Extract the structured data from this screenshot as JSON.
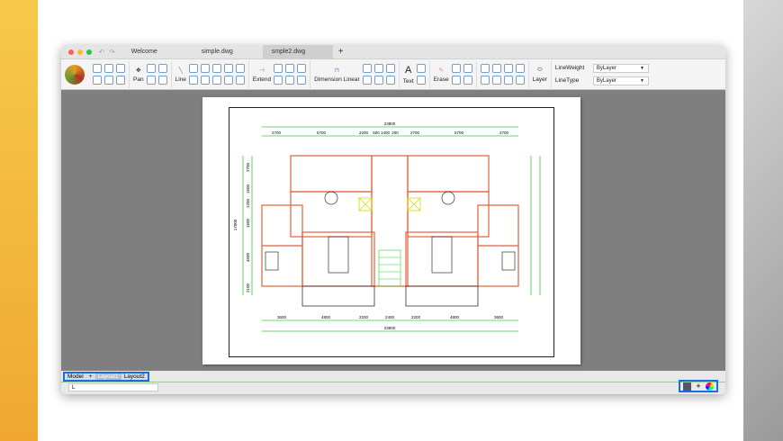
{
  "tabs": [
    "Welcome",
    "simple.dwg",
    "smple2.dwg"
  ],
  "toolbar": {
    "pan": "Pan",
    "line": "Line",
    "extend": "Extend",
    "dimension": "Dimension Linear",
    "text": "Text",
    "erase": "Erase",
    "layer": "Layer",
    "lineweight_label": "LineWeight",
    "lineweight_value": "ByLayer",
    "linetype_label": "LineType",
    "linetype_value": "ByLayer",
    "text_glyph": "A"
  },
  "drawing": {
    "top_total": "23800",
    "top_dims": [
      "2700",
      "5700",
      "2200",
      "500",
      "1400",
      "200",
      "2700",
      "5700",
      "2700"
    ],
    "bottom_dims": [
      "3600",
      "4800",
      "2200",
      "2400",
      "2200",
      "4800",
      "3600"
    ],
    "bottom_total": "23800",
    "side_total": "17000",
    "side_dims": [
      "2700",
      "1500",
      "1200",
      "1500",
      "4500",
      "2100"
    ]
  },
  "layouts": [
    "Model",
    "+",
    "Layout1",
    "Layout2"
  ],
  "command_value": "L"
}
